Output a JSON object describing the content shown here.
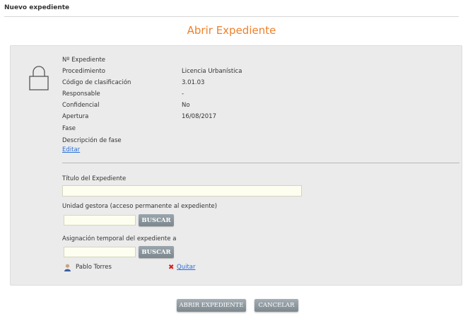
{
  "header": {
    "section_title": "Nuevo expediente",
    "page_title": "Abrir Expediente"
  },
  "details": {
    "fields": [
      {
        "label": "Nº Expediente",
        "value": ""
      },
      {
        "label": "Procedimiento",
        "value": "Licencia Urbanística"
      },
      {
        "label": "Código de clasificación",
        "value": "3.01.03"
      },
      {
        "label": "Responsable",
        "value": "-"
      },
      {
        "label": "Confidencial",
        "value": "No"
      },
      {
        "label": "Apertura",
        "value": "16/08/2017"
      },
      {
        "label": "Fase",
        "value": ""
      },
      {
        "label": "Descripción de fase",
        "value": ""
      }
    ],
    "edit_link": "Editar",
    "lock_icon": "lock-icon"
  },
  "form": {
    "title_label": "Título del Expediente",
    "title_value": "",
    "unit_label": "Unidad gestora (acceso permanente al expediente)",
    "unit_value": "",
    "unit_search": "BUSCAR",
    "temp_label": "Asignación temporal del expediente a",
    "temp_value": "",
    "temp_search": "BUSCAR",
    "assigned_user": "Pablo Torres",
    "remove_link": "Quitar"
  },
  "actions": {
    "open": "ABRIR EXPEDIENTE",
    "cancel": "CANCELAR"
  },
  "colors": {
    "accent": "#f0802a",
    "link": "#2a6fd6",
    "input_bg": "#fefef0",
    "button": "#8a959b",
    "panel": "#ebebeb"
  }
}
